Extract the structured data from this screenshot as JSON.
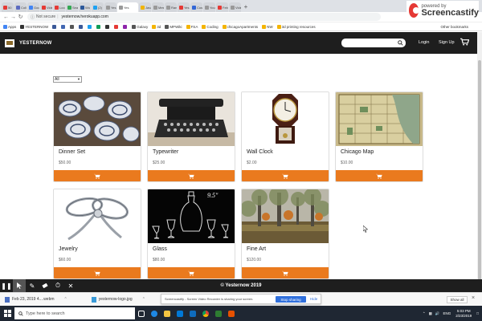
{
  "browser": {
    "tabs": [
      {
        "label": "50 ",
        "color": "#e53935"
      },
      {
        "label": "Coll",
        "color": "#5c6bc0"
      },
      {
        "label": "Goo",
        "color": "#4285f4"
      },
      {
        "label": "Vide",
        "color": "#e53935"
      },
      {
        "label": "Loo",
        "color": "#e53935"
      },
      {
        "label": "Sea",
        "color": "#34a853"
      },
      {
        "label": "Wo",
        "color": "#2b579a"
      },
      {
        "label": "(2) ",
        "color": "#1da1f2"
      },
      {
        "label": "Yes",
        "color": "#999999"
      },
      {
        "label": "Yes",
        "color": "#999999",
        "active": true
      },
      {
        "label": "Java",
        "color": "#f0b400"
      },
      {
        "label": "Mes",
        "color": "#999999"
      },
      {
        "label": "Ran",
        "color": "#999999"
      },
      {
        "label": "Yes",
        "color": "#e53935"
      },
      {
        "label": "Cus",
        "color": "#3367d6"
      },
      {
        "label": "You",
        "color": "#999999"
      },
      {
        "label": "Feb",
        "color": "#e53935"
      },
      {
        "label": "Vide",
        "color": "#999999"
      }
    ],
    "new_tab": "+",
    "not_secure": "Not secure",
    "url": "yesternow.herokuapp.com",
    "bookmarks": [
      {
        "label": "Apps",
        "color": "#4285f4"
      },
      {
        "label": "YESTERNOW",
        "color": "#333333"
      },
      {
        "label": "",
        "color": "#3b5998"
      },
      {
        "label": "",
        "color": "#4267b2"
      },
      {
        "label": "",
        "color": "#555555"
      },
      {
        "label": "",
        "color": "#3b5998"
      },
      {
        "label": "",
        "color": "#1da1f2"
      },
      {
        "label": "",
        "color": "#0f9d58"
      },
      {
        "label": "",
        "color": "#333333"
      },
      {
        "label": "",
        "color": "#e53935"
      },
      {
        "label": "",
        "color": "#8e24aa"
      },
      {
        "label": "Galaxy",
        "color": "#555555"
      },
      {
        "label": "3d",
        "color": "#f4b400"
      },
      {
        "label": "MPWiki",
        "color": "#555555"
      },
      {
        "label": "FSA",
        "color": "#f4b400"
      },
      {
        "label": "Coding",
        "color": "#f4b400"
      },
      {
        "label": "chicagoApartments",
        "color": "#f4b400"
      },
      {
        "label": "NW",
        "color": "#f4b400"
      },
      {
        "label": "3d printing resources",
        "color": "#f4b400"
      }
    ],
    "other_bookmarks": "Other bookmarks"
  },
  "screencastify": {
    "powered_by": "powered by",
    "brand": "Screencastify"
  },
  "site": {
    "brand": "YESTERNOW",
    "search_placeholder": "",
    "login": "Login",
    "signup": "Sign Up",
    "filter_value": "All",
    "footer": "© Yesternow 2019"
  },
  "products": [
    {
      "name": "Dinner Set",
      "price": "$50.00",
      "image": "dinner-set-photo"
    },
    {
      "name": "Typewriter",
      "price": "$25.00",
      "image": "typewriter-photo"
    },
    {
      "name": "Wall Clock",
      "price": "$2.00",
      "image": "wall-clock-photo"
    },
    {
      "name": "Chicago Map",
      "price": "$10.00",
      "image": "chicago-map-photo"
    },
    {
      "name": "Jewelry",
      "price": "$60.00",
      "image": "jewelry-photo"
    },
    {
      "name": "Glass",
      "price": "$80.00",
      "image": "glass-photo",
      "image_caption": "9.5\""
    },
    {
      "name": "Fine Art",
      "price": "$120.00",
      "image": "fine-art-photo"
    }
  ],
  "downloads": {
    "items": [
      {
        "label": "Feb 23, 2019 4....webm"
      },
      {
        "label": "yesternow-logo.jpg"
      }
    ],
    "sharing_text": "Screencastify - Screen Video Recorder is sharing your screen.",
    "stop_sharing": "Stop sharing",
    "hide": "Hide",
    "show_all": "Show all",
    "close": "×"
  },
  "taskbar": {
    "search_placeholder": "Type here to search",
    "lang": "ENG",
    "time": "5:03 PM",
    "date": "2/23/2019"
  },
  "colors": {
    "accent": "#ea7a1e",
    "navbar": "#1e1e1e"
  }
}
